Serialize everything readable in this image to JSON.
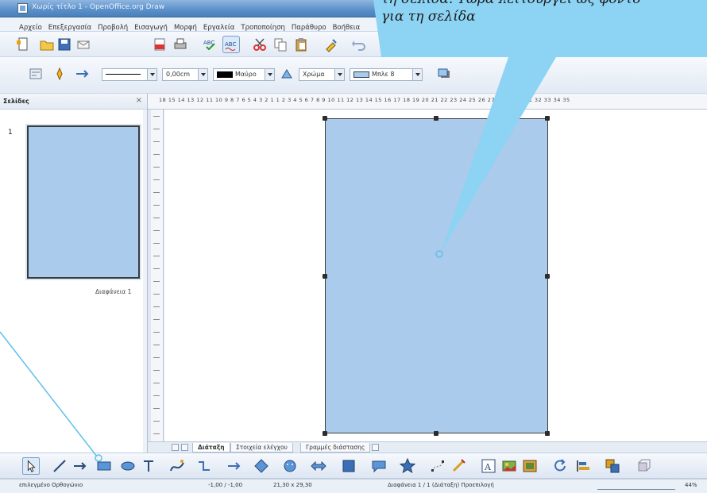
{
  "window": {
    "title": "Χωρίς τίτλο 1 - OpenOffice.org Draw"
  },
  "menubar": {
    "items": [
      "Αρχείο",
      "Επεξεργασία",
      "Προβολή",
      "Εισαγωγή",
      "Μορφή",
      "Εργαλεία",
      "Τροποποίηση",
      "Παράθυρο",
      "Βοήθεια"
    ]
  },
  "line_toolbar": {
    "line_width": "0,00cm",
    "line_color": "Μαύρο",
    "area_style": "Χρώμα",
    "area_color": "Μπλε 8"
  },
  "slides_pane": {
    "title": "Σελίδες",
    "slide_number": "1",
    "thumb_label": "Διαφάνεια 1"
  },
  "ruler": {
    "ticks": "18 15 14 13 12 11 10 9  8  7  6  5  4  3  2  1        1  2  3  4  5  6  7  8  9 10 11 12 13 14 15 16 17 18 19 20 21 22 23 24 25 26 27 28 29 30 31 32 33 34 35"
  },
  "tabs": {
    "layout": "Διάταξη",
    "controls": "Στοιχεία ελέγχου",
    "dimension_lines": "Γραμμές διάστασης"
  },
  "statusbar": {
    "hint": "επιλεγμένο Ορθογώνιο",
    "position": "-1,00 / -1,00",
    "size": "21,30 x 29,30",
    "page": "Διαφάνεια 1 / 1 (Διάταξη) Προεπιλογή",
    "zoom": "44%"
  },
  "callout": {
    "line1": "τη σελίδα. Τώρα λειτουργεί ως φόντο",
    "line2": "για τη σελίδα"
  },
  "colors": {
    "page_fill": "#aacbeb",
    "callout_fill": "#8dd3f3",
    "leader_line": "#5fc1ea"
  }
}
